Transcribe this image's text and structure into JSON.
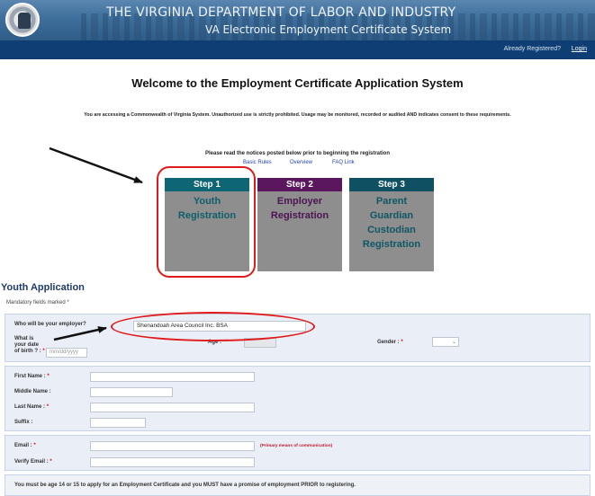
{
  "header": {
    "title": "THE VIRGINIA DEPARTMENT OF LABOR AND INDUSTRY",
    "subtitle": "VA Electronic Employment Certificate System",
    "already_registered": "Already Registered?",
    "login": "Login"
  },
  "welcome": "Welcome to the Employment Certificate Application System",
  "notice": "You are accessing a Commonwealth of Virginia System. Unauthorized use is strictly prohibited. Usage may be monitored, recorded or audited AND indicates consent to these requirements.",
  "please_read": "Please read the notices posted below prior to beginning the registration",
  "links": {
    "basic_rules": "Basic Rules",
    "overview": "Overview",
    "faq": "FAQ Link"
  },
  "steps": [
    {
      "step": "Step 1",
      "l1": "Youth",
      "l2": "Registration",
      "l3": "",
      "l4": ""
    },
    {
      "step": "Step 2",
      "l1": "Employer",
      "l2": "Registration",
      "l3": "",
      "l4": ""
    },
    {
      "step": "Step 3",
      "l1": "Parent",
      "l2": "Guardian",
      "l3": "Custodian",
      "l4": "Registration"
    }
  ],
  "form": {
    "title": "Youth Application",
    "mandatory": "Mandatory fields marked *",
    "employer_label": "Who will be your employer?",
    "employer_value": "Shenandoah Area Council Inc. BSA",
    "dob_l1": "What is",
    "dob_l2": "your date",
    "dob_l3": "of birth ? :",
    "dob_placeholder": "mm/dd/yyyy",
    "age_label": "Age :",
    "gender_label": "Gender :",
    "first_name": "First Name :",
    "middle_name": "Middle Name :",
    "last_name": "Last Name :",
    "suffix": "Suffix :",
    "email": "Email :",
    "email_hint": "(Primary means of communication)",
    "verify_email": "Verify Email :",
    "req": "*",
    "footer": "You must be age 14 or 15 to apply for an Employment Certificate and you MUST have a promise of employment PRIOR to registering."
  },
  "colors": {
    "banner": "#3f6f9c",
    "navbar": "#0e3e73",
    "annotation": "#e01a1a",
    "step1": "#0e6674",
    "step2": "#5a175e",
    "step3": "#0f5063"
  }
}
